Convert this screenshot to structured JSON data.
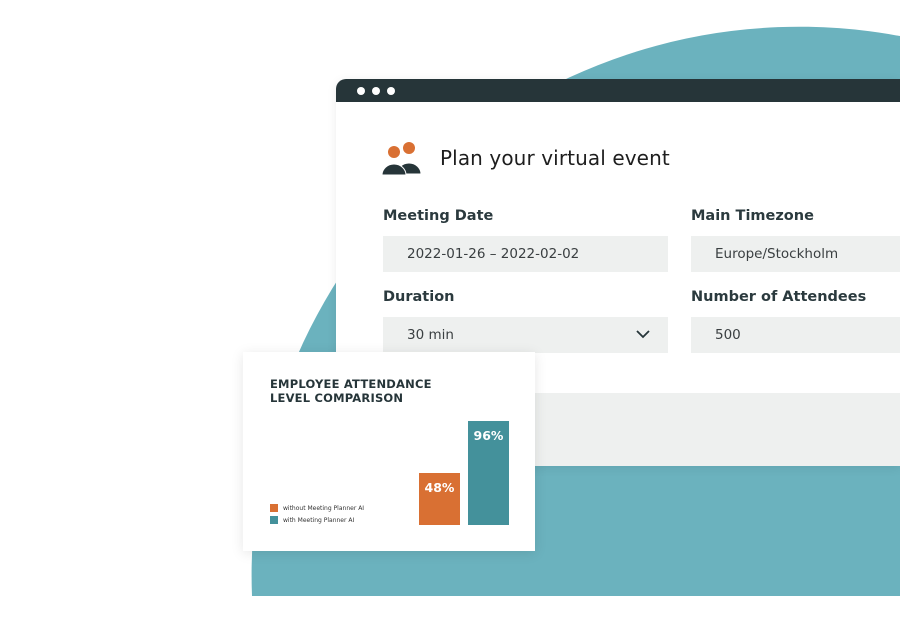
{
  "colors": {
    "teal_bg": "#6bb2be",
    "dark": "#263539",
    "orange": "#d97033",
    "teal_bar": "#44919b",
    "field_bg": "#eef0ef"
  },
  "window": {
    "title": "Plan your virtual event",
    "icon": "people-icon",
    "fields": {
      "meeting_date": {
        "label": "Meeting Date",
        "value": "2022-01-26 – 2022-02-02"
      },
      "main_timezone": {
        "label": "Main Timezone",
        "value": "Europe/Stockholm"
      },
      "duration": {
        "label": "Duration",
        "value": "30 min",
        "icon": "chevron-down-icon"
      },
      "attendees": {
        "label": "Number of Attendees",
        "value": "500"
      }
    }
  },
  "chart_data": {
    "type": "bar",
    "title": "EMPLOYEE ATTENDANCE LEVEL COMPARISON",
    "title_line1": "EMPLOYEE ATTENDANCE",
    "title_line2": "LEVEL COMPARISON",
    "categories": [
      "without Meeting Planner AI",
      "with Meeting Planner AI"
    ],
    "values": [
      48,
      96
    ],
    "data_labels": [
      "48%",
      "96%"
    ],
    "ylim": [
      0,
      100
    ],
    "legend_placement": "bottom-left",
    "grid": false
  }
}
